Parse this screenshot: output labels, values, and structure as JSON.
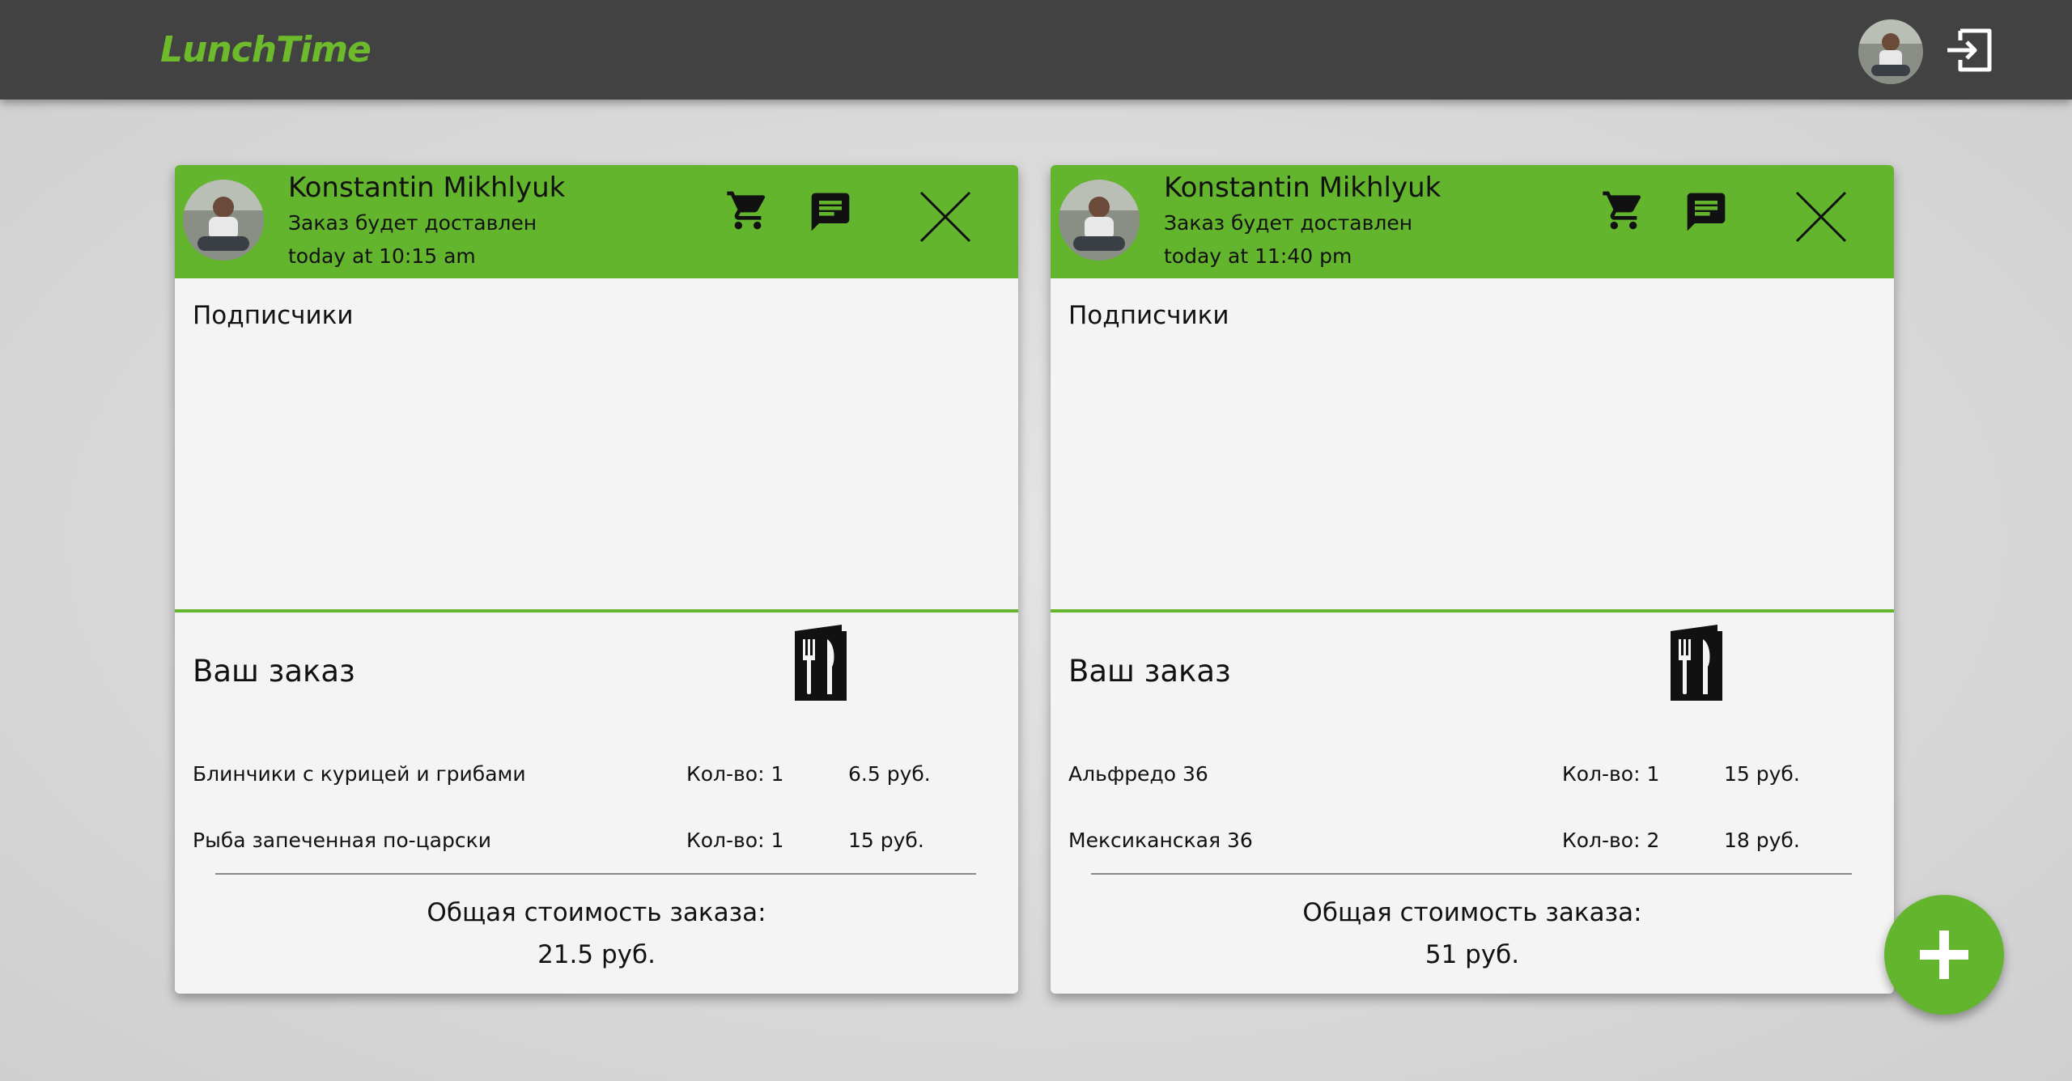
{
  "header": {
    "logo": "LunchTime"
  },
  "colors": {
    "brand_green": "#64b52e",
    "topbar": "#424242",
    "card_background": "#f4f4f4"
  },
  "icons": {
    "cart": "cart-icon",
    "chat": "chat-icon",
    "close": "close-icon",
    "menu": "menu-icon",
    "logout": "logout-icon",
    "add": "plus-icon"
  },
  "orders": [
    {
      "user_name": "Konstantin Mikhlyuk",
      "delivery_label": "Заказ будет доставлен",
      "delivery_time": "today at 10:15 am",
      "subscribers_label": "Подписчики",
      "order_title": "Ваш заказ",
      "items": [
        {
          "name": "Блинчики с курицей и грибами",
          "qty": "Кол-во: 1",
          "price": "6.5 руб."
        },
        {
          "name": "Рыба запеченная по-царски",
          "qty": "Кол-во: 1",
          "price": "15 руб."
        }
      ],
      "total_label": "Общая стоимость заказа:",
      "total_value": "21.5 руб."
    },
    {
      "user_name": "Konstantin Mikhlyuk",
      "delivery_label": "Заказ будет доставлен",
      "delivery_time": "today at 11:40 pm",
      "subscribers_label": "Подписчики",
      "order_title": "Ваш заказ",
      "items": [
        {
          "name": "Альфредо 36",
          "qty": "Кол-во: 1",
          "price": "15 руб."
        },
        {
          "name": "Мексиканская 36",
          "qty": "Кол-во: 2",
          "price": "18 руб."
        }
      ],
      "total_label": "Общая стоимость заказа:",
      "total_value": "51 руб."
    }
  ]
}
